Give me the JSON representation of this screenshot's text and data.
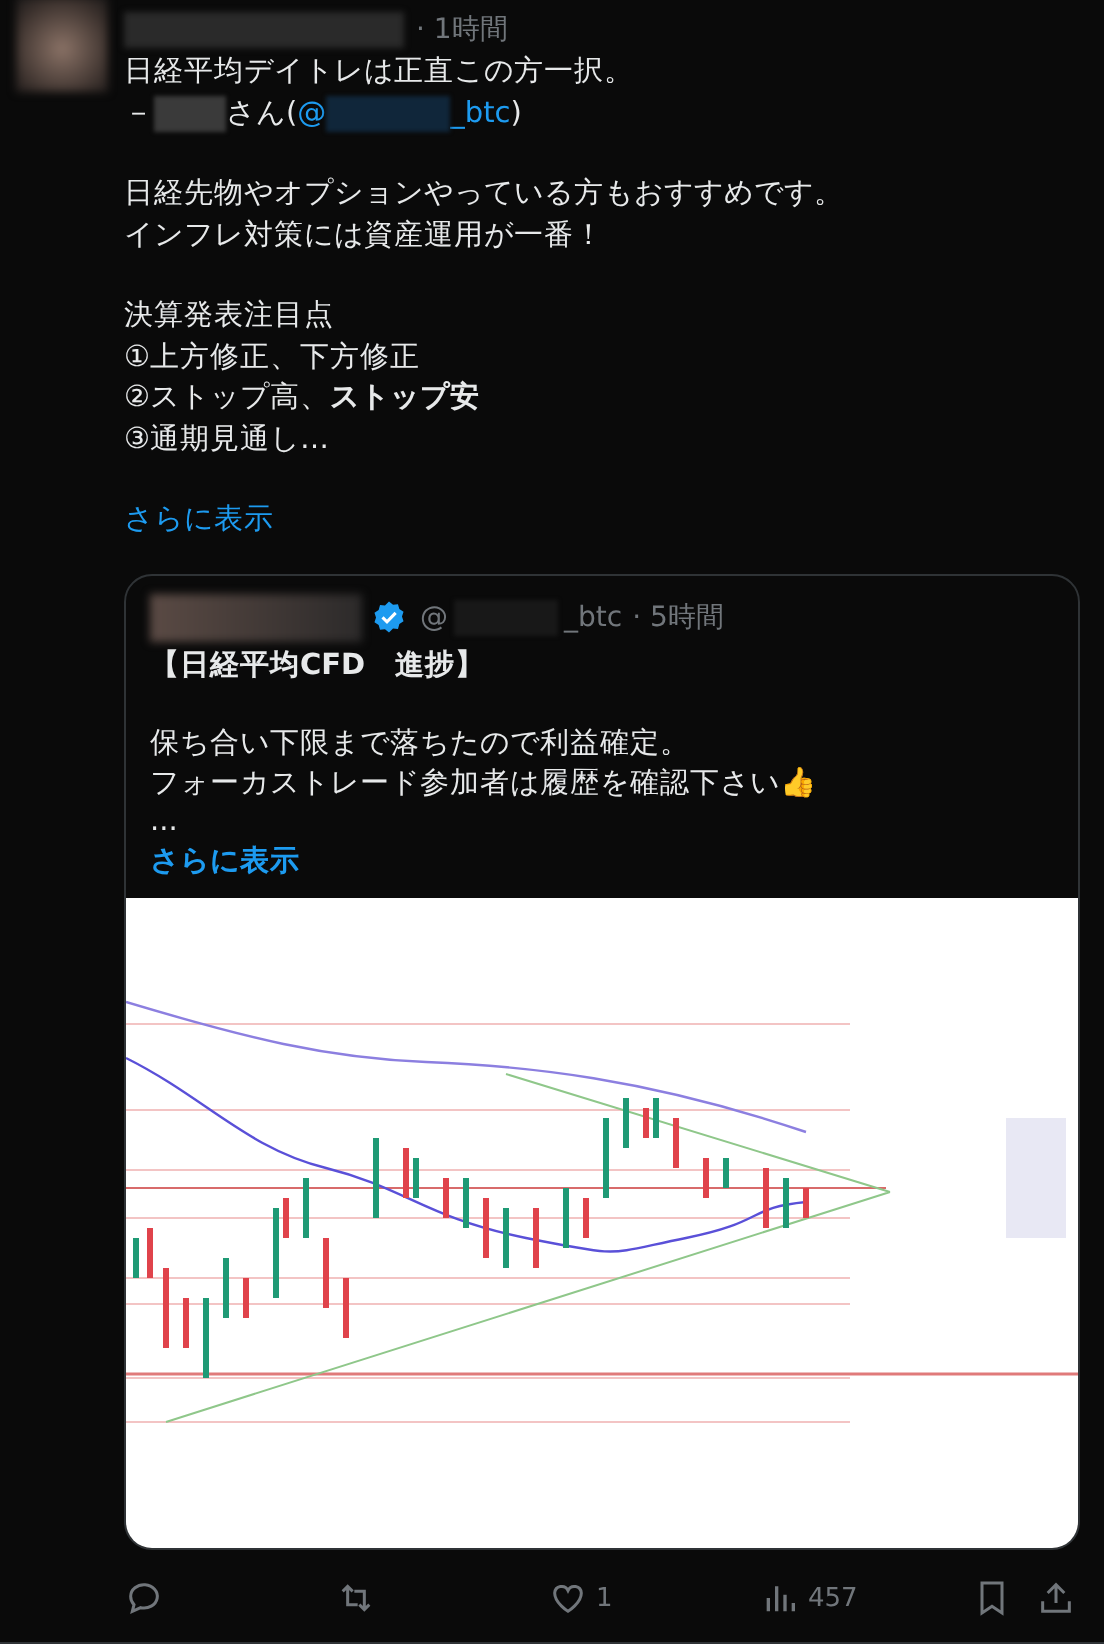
{
  "post": {
    "time": "· 1時間",
    "paragraphs": [
      {
        "kind": "lead",
        "lines": [
          "日経平均デイトレは正直この方一択。"
        ],
        "credit": {
          "prefix": "－",
          "suffix": "さん(",
          "mention_start": "@",
          "mention_end": "_btc",
          "close": ")"
        }
      },
      {
        "kind": "plain",
        "lines": [
          "日経先物やオプションやっている方もおすすめです。",
          "インフレ対策には資産運用が一番！"
        ]
      },
      {
        "kind": "plain",
        "lines": [
          "決算発表注目点",
          "①上方修正、下方修正",
          "②ストップ高、**ストップ安**",
          "③通期見通し…"
        ]
      }
    ],
    "show_more": "さらに表示",
    "quote": {
      "verified": true,
      "handle_start": "@",
      "handle_end": "_btc",
      "time": "· 5時間",
      "title": "【日経平均CFD　進捗】",
      "lines": [
        "保ち合い下限まで落ちたので利益確定。",
        "フォーカストレード参加者は履歴を確認下さい👍",
        "..."
      ],
      "show_more": "さらに表示",
      "media": {
        "kind": "picture"
      }
    },
    "actions": [
      {
        "kind": "reply"
      },
      {
        "kind": "repost"
      },
      {
        "kind": "like",
        "count": "1"
      },
      {
        "kind": "views",
        "count": "457"
      },
      {
        "kind": "bookmark"
      },
      {
        "kind": "share"
      }
    ]
  }
}
